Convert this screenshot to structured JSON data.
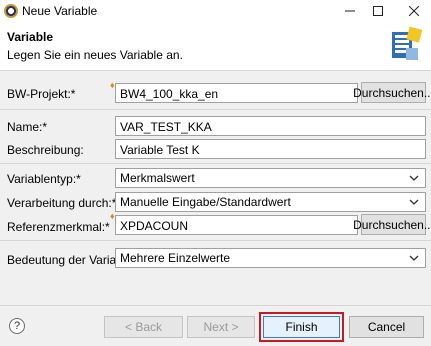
{
  "window": {
    "title": "Neue Variable"
  },
  "header": {
    "title": "Variable",
    "subtitle": "Legen Sie ein neues Variable an."
  },
  "form": {
    "bw_projekt": {
      "label": "BW-Projekt:*",
      "value": "BW4_100_kka_en",
      "button": "Durchsuchen..."
    },
    "name": {
      "label": "Name:*",
      "value": "VAR_TEST_KKA"
    },
    "beschreibung": {
      "label": "Beschreibung:",
      "value": "Variable Test K"
    },
    "variablentyp": {
      "label": "Variablentyp:*",
      "value": "Merkmalswert"
    },
    "verarbeitung": {
      "label": "Verarbeitung durch:*",
      "value": "Manuelle Eingabe/Standardwert"
    },
    "referenzmerkmal": {
      "label": "Referenzmerkmal:*",
      "value": "XPDACOUN",
      "button": "Durchsuchen..."
    },
    "bedeutung": {
      "label": "Bedeutung der Variable:*",
      "value": "Mehrere Einzelwerte"
    }
  },
  "footer": {
    "help": "?",
    "back": "< Back",
    "next": "Next >",
    "finish": "Finish",
    "cancel": "Cancel"
  },
  "accent": {
    "highlight": "#c41b24",
    "required_marker": "#d08a2a"
  }
}
